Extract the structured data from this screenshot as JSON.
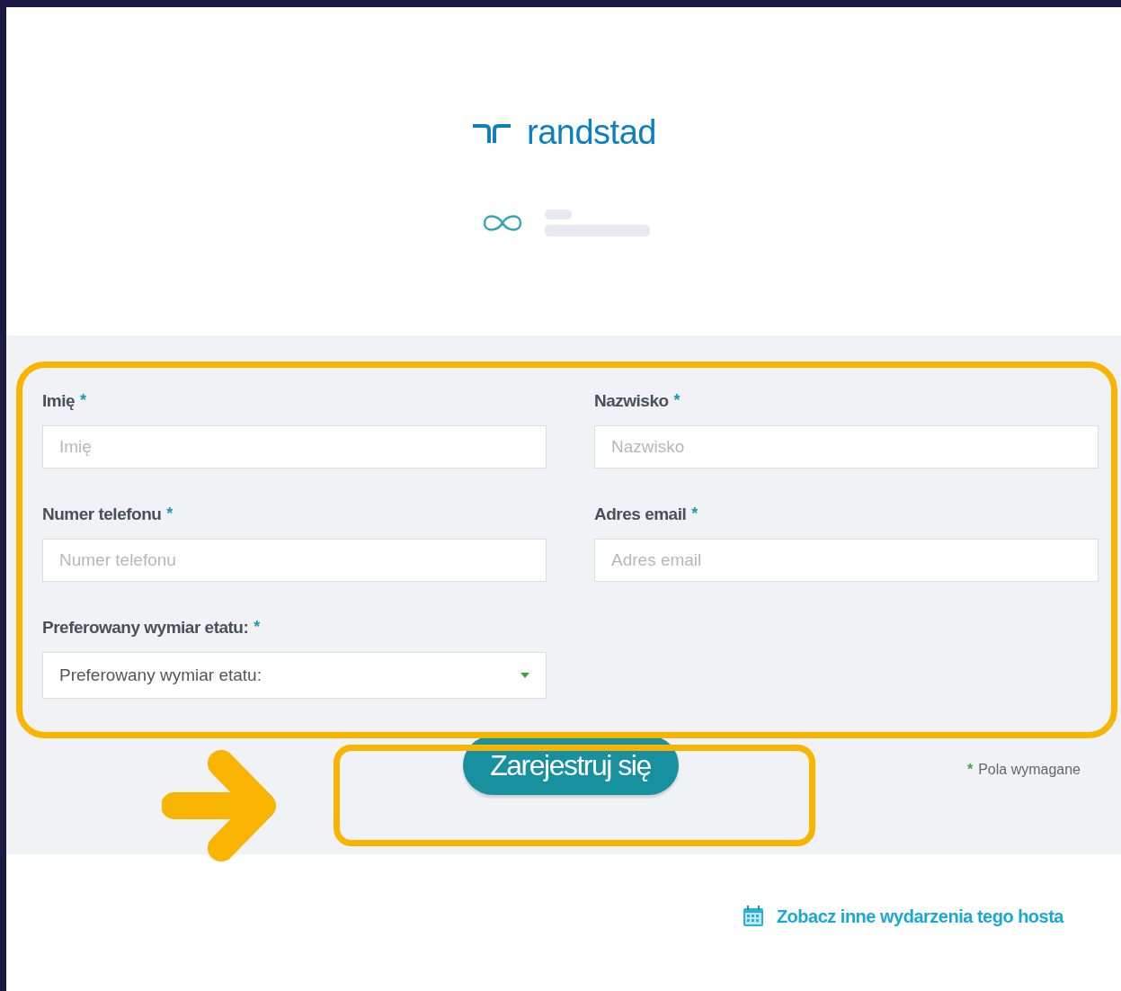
{
  "header": {
    "logo_text": "randstad"
  },
  "form": {
    "fields": [
      {
        "kind": "text",
        "label": "Imię",
        "mark": "*",
        "placeholder": "Imię"
      },
      {
        "kind": "text",
        "label": "Nazwisko",
        "mark": "*",
        "placeholder": "Nazwisko"
      },
      {
        "kind": "text",
        "label": "Numer telefonu",
        "mark": "*",
        "placeholder": "Numer telefonu"
      },
      {
        "kind": "text",
        "label": "Adres email",
        "mark": "*",
        "placeholder": "Adres email"
      },
      {
        "kind": "select",
        "label": "Preferowany wymiar etatu:",
        "mark": "*",
        "value": "Preferowany wymiar etatu:"
      }
    ],
    "submit": "Zarejestruj się",
    "required_note": {
      "mark": "*",
      "text": "Pola wymagane"
    }
  },
  "footer": {
    "link": "Zobacz inne wydarzenia tego hosta"
  }
}
